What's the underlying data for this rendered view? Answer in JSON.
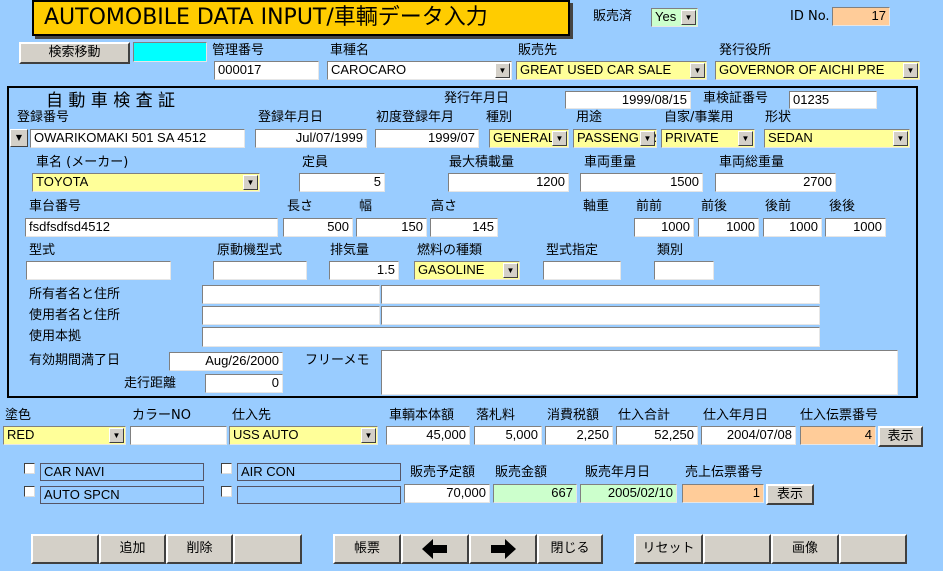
{
  "header": {
    "title": "AUTOMOBILE DATA INPUT/車輌データ入力",
    "sold_label": "販売済",
    "sold_value": "Yes",
    "id_label": "ID No.",
    "id_value": "17"
  },
  "top": {
    "search_button": "検索移動",
    "mgmt_label": "管理番号",
    "mgmt_value": "000017",
    "model_label": "車種名",
    "model_value": "CAROCARO",
    "seller_label": "販売先",
    "seller_value": "GREAT USED CAR SALE",
    "office_label": "発行役所",
    "office_value": "GOVERNOR OF AICHI PRE"
  },
  "inspection": {
    "heading": "自 動 車 検 査 証",
    "issue_date_label": "発行年月日",
    "issue_date": "1999/08/15",
    "cert_no_label": "車検証番号",
    "cert_no": "01235",
    "reg_no_label": "登録番号",
    "reg_no": "OWARIKOMAKI 501 SA 4512",
    "reg_date_label": "登録年月日",
    "reg_date": "Jul/07/1999",
    "first_reg_label": "初度登録年月",
    "first_reg": "1999/07",
    "kind_label": "種別",
    "kind": "GENERAL",
    "use_label": "用途",
    "use": "PASSENGER",
    "private_label": "自家/事業用",
    "private": "PRIVATE",
    "shape_label": "形状",
    "shape": "SEDAN",
    "maker_label": "車名 (メーカー)",
    "maker": "TOYOTA",
    "capacity_label": "定員",
    "capacity": "5",
    "max_load_label": "最大積載量",
    "max_load": "1200",
    "weight_label": "車両重量",
    "weight": "1500",
    "gross_label": "車両総重量",
    "gross": "2700",
    "chassis_label": "車台番号",
    "chassis": "fsdfsdfsd4512",
    "length_label": "長さ",
    "length": "500",
    "width_label": "幅",
    "width": "150",
    "height_label": "高さ",
    "height": "145",
    "axle_label": "軸重",
    "ff_label": "前前",
    "ff": "1000",
    "fr_label": "前後",
    "fr": "1000",
    "rf_label": "後前",
    "rf": "1000",
    "rr_label": "後後",
    "rr": "1000",
    "type_label": "型式",
    "type": "",
    "engine_type_label": "原動機型式",
    "engine_type": "",
    "displacement_label": "排気量",
    "displacement": "1.5",
    "fuel_label": "燃料の種類",
    "fuel": "GASOLINE",
    "type_designation_label": "型式指定",
    "type_designation": "",
    "category_label": "類別",
    "category": "",
    "owner_label": "所有者名と住所",
    "user_label": "使用者名と住所",
    "base_label": "使用本拠",
    "expiry_label": "有効期間満了日",
    "expiry": "Aug/26/2000",
    "memo_label": "フリーメモ",
    "mileage_label": "走行距離",
    "mileage": "0"
  },
  "purchase": {
    "color_label": "塗色",
    "color": "RED",
    "color_no_label": "カラーNO",
    "color_no": "",
    "supplier_label": "仕入先",
    "supplier": "USS AUTO",
    "body_price_label": "車輌本体額",
    "body_price": "45,000",
    "fee_label": "落札料",
    "fee": "5,000",
    "tax_label": "消費税額",
    "tax": "2,250",
    "total_label": "仕入合計",
    "total": "52,250",
    "date_label": "仕入年月日",
    "date": "2004/07/08",
    "slip_label": "仕入伝票番号",
    "slip": "4",
    "show_button": "表示"
  },
  "options": {
    "opt1": "CAR NAVI",
    "opt2": "AUTO SPCN",
    "opt3": "AIR CON",
    "opt4": ""
  },
  "sales": {
    "planned_label": "販売予定額",
    "planned": "70,000",
    "amount_label": "販売金額",
    "amount": "667",
    "date_label": "販売年月日",
    "date": "2005/02/10",
    "slip_label": "売上伝票番号",
    "slip": "1",
    "show_button": "表示"
  },
  "toolbar": {
    "add": "追加",
    "delete": "削除",
    "report": "帳票",
    "close": "閉じる",
    "reset": "リセット",
    "image": "画像"
  }
}
